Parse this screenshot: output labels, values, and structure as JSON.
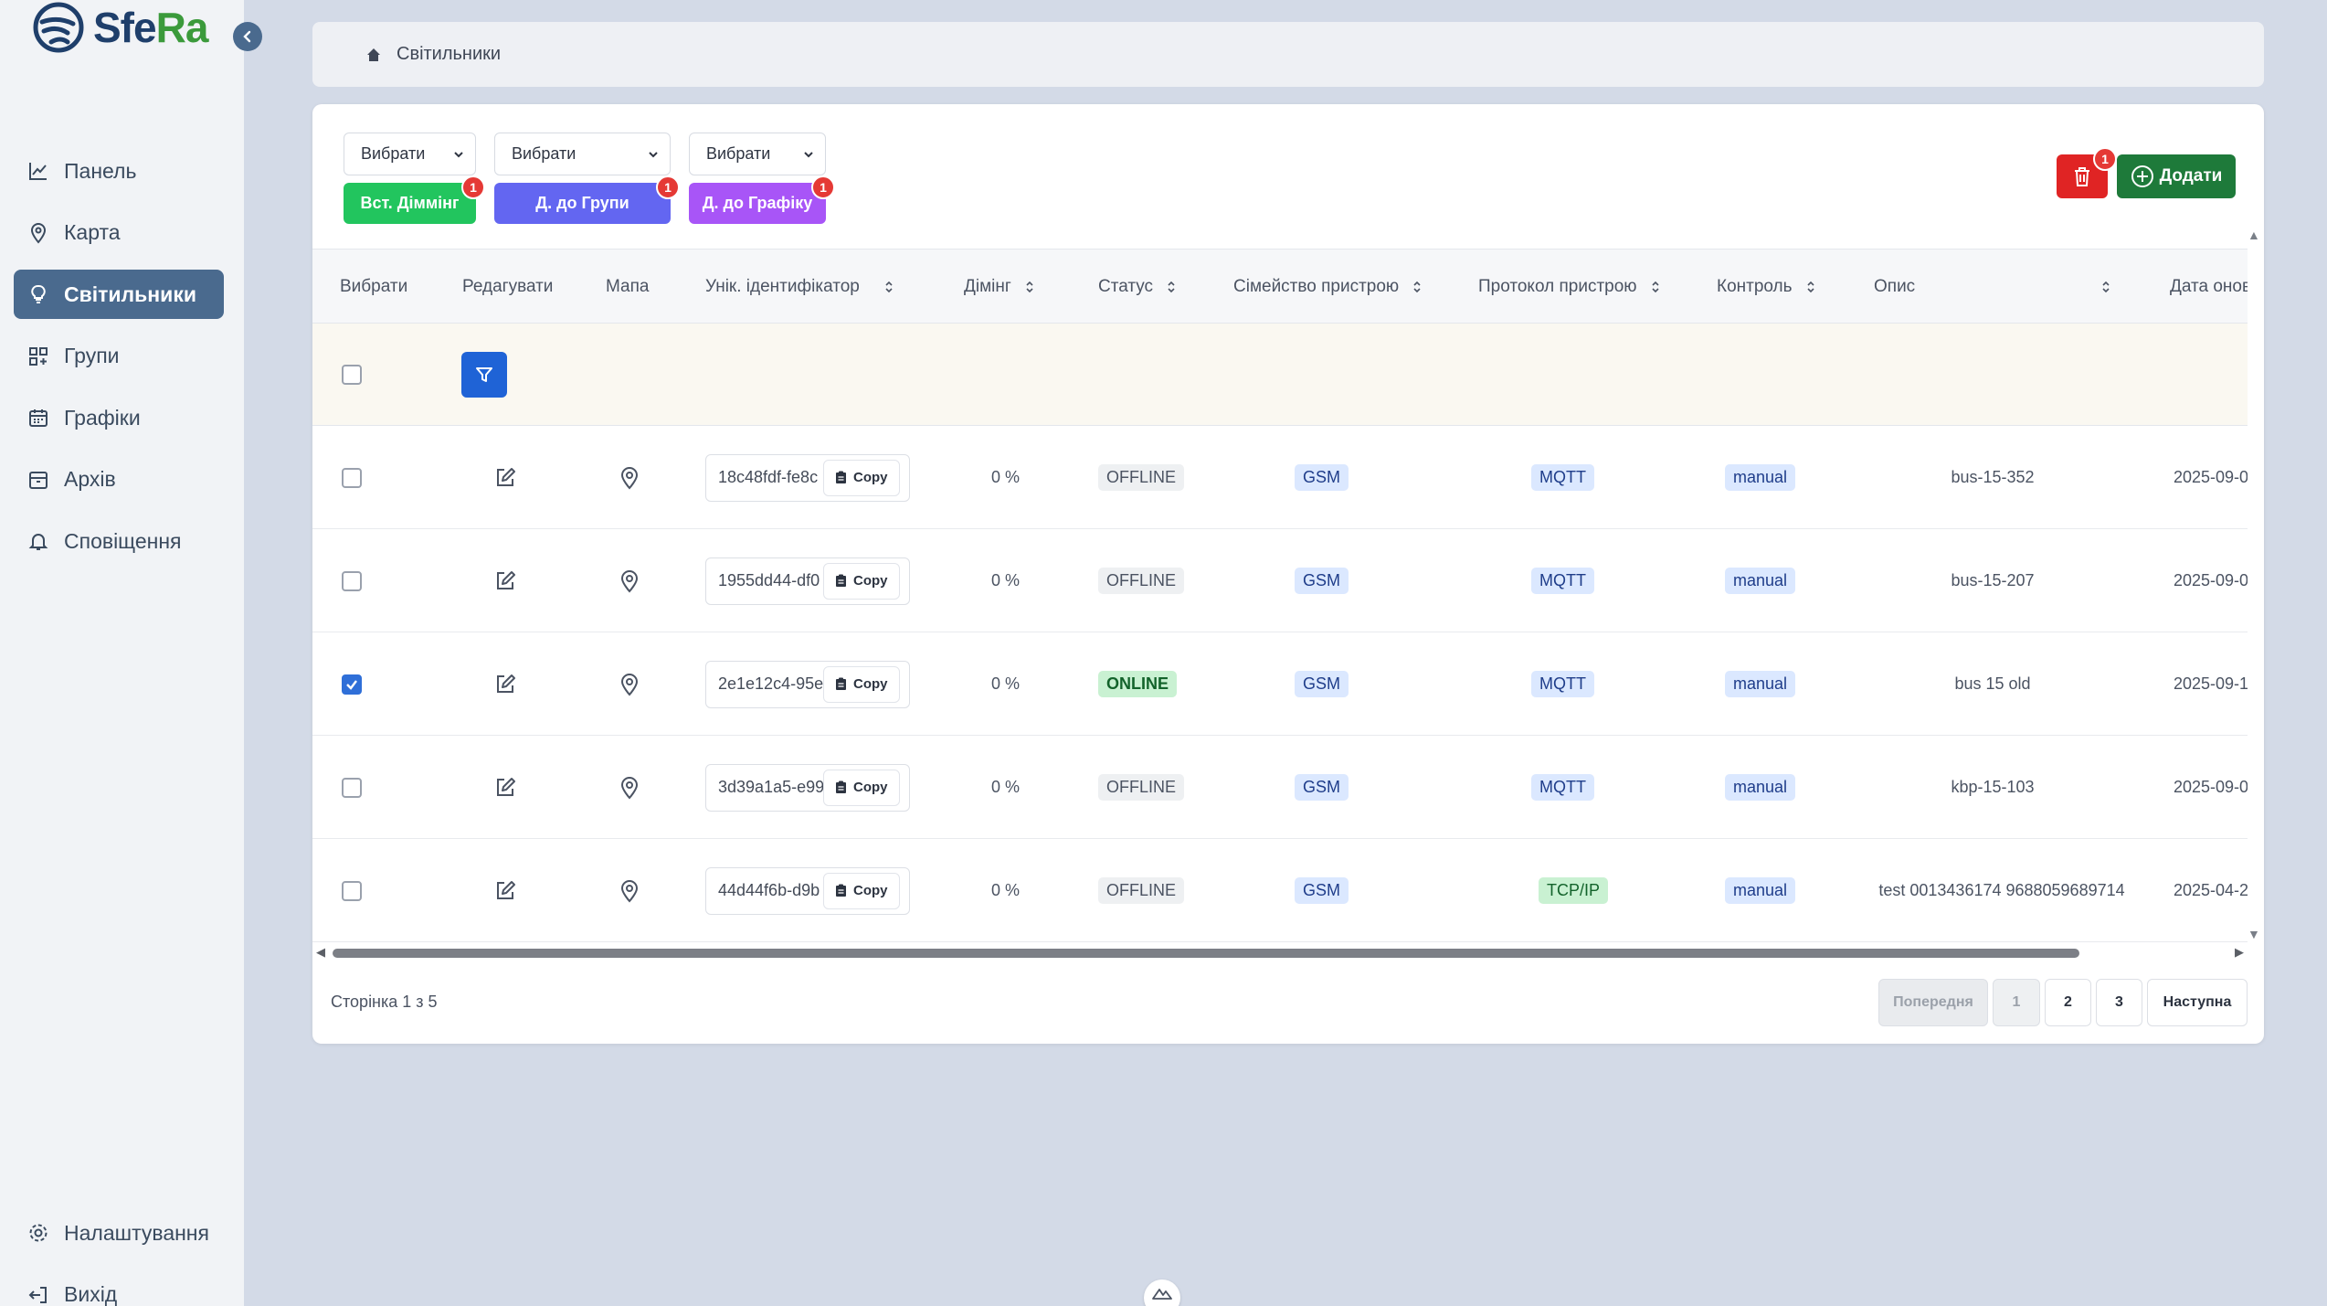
{
  "brand": {
    "part1": "Sfe",
    "part2": "Ra"
  },
  "sidebar": {
    "items": [
      {
        "label": "Панель",
        "icon": "chart-line-icon"
      },
      {
        "label": "Карта",
        "icon": "map-pin-icon"
      },
      {
        "label": "Світильники",
        "icon": "lightbulb-icon",
        "active": true
      },
      {
        "label": "Групи",
        "icon": "grid-plus-icon"
      },
      {
        "label": "Графіки",
        "icon": "calendar-icon"
      },
      {
        "label": "Архів",
        "icon": "archive-icon"
      },
      {
        "label": "Сповіщення",
        "icon": "bell-icon"
      }
    ],
    "bottom": [
      {
        "label": "Налаштування",
        "icon": "gear-icon"
      },
      {
        "label": "Вихід",
        "icon": "logout-icon"
      }
    ]
  },
  "breadcrumb": {
    "current": "Світильники"
  },
  "toolbar": {
    "select1": "Вибрати",
    "select2": "Вибрати",
    "select3": "Вибрати",
    "dimming_label": "Вст. Діммінг",
    "group_label": "Д. до Групи",
    "schedule_label": "Д. до Графіку",
    "badge": "1",
    "delete_badge": "1",
    "add_label": "Додати",
    "colors": {
      "dimming": "#22c55e",
      "group": "#6366f1",
      "schedule": "#a855f7",
      "delete": "#e02424",
      "add": "#1e7a3a"
    }
  },
  "table": {
    "headers": {
      "select": "Вибрати",
      "edit": "Редагувати",
      "map": "Мапа",
      "uid": "Унік. ідентифікатор",
      "dimming": "Дімінг",
      "status": "Статус",
      "family": "Сімейство пристрою",
      "protocol": "Протокол пристрою",
      "control": "Контроль",
      "description": "Опис",
      "updated": "Дата оновлення"
    },
    "copy_label": "Copy",
    "rows": [
      {
        "checked": false,
        "uid": "18c48fdf-fe8c",
        "dimming": "0 %",
        "status": "OFFLINE",
        "family": "GSM",
        "protocol": "MQTT",
        "control": "manual",
        "description": "bus-15-352",
        "updated": "2025-09-0"
      },
      {
        "checked": false,
        "uid": "1955dd44-df0",
        "dimming": "0 %",
        "status": "OFFLINE",
        "family": "GSM",
        "protocol": "MQTT",
        "control": "manual",
        "description": "bus-15-207",
        "updated": "2025-09-0"
      },
      {
        "checked": true,
        "uid": "2e1e12c4-95e",
        "dimming": "0 %",
        "status": "ONLINE",
        "family": "GSM",
        "protocol": "MQTT",
        "control": "manual",
        "description": "bus 15 old",
        "updated": "2025-09-1"
      },
      {
        "checked": false,
        "uid": "3d39a1a5-e99",
        "dimming": "0 %",
        "status": "OFFLINE",
        "family": "GSM",
        "protocol": "MQTT",
        "control": "manual",
        "description": "kbp-15-103",
        "updated": "2025-09-0"
      },
      {
        "checked": false,
        "uid": "44d44f6b-d9b",
        "dimming": "0 %",
        "status": "OFFLINE",
        "family": "GSM",
        "protocol": "TCP/IP",
        "control": "manual",
        "description": "test 0013436174 9688059689714",
        "updated": "2025-04-2"
      }
    ]
  },
  "pagination": {
    "info": "Сторінка 1 з 5",
    "prev": "Попередня",
    "pages": [
      "1",
      "2",
      "3"
    ],
    "current": "1",
    "next": "Наступна"
  }
}
